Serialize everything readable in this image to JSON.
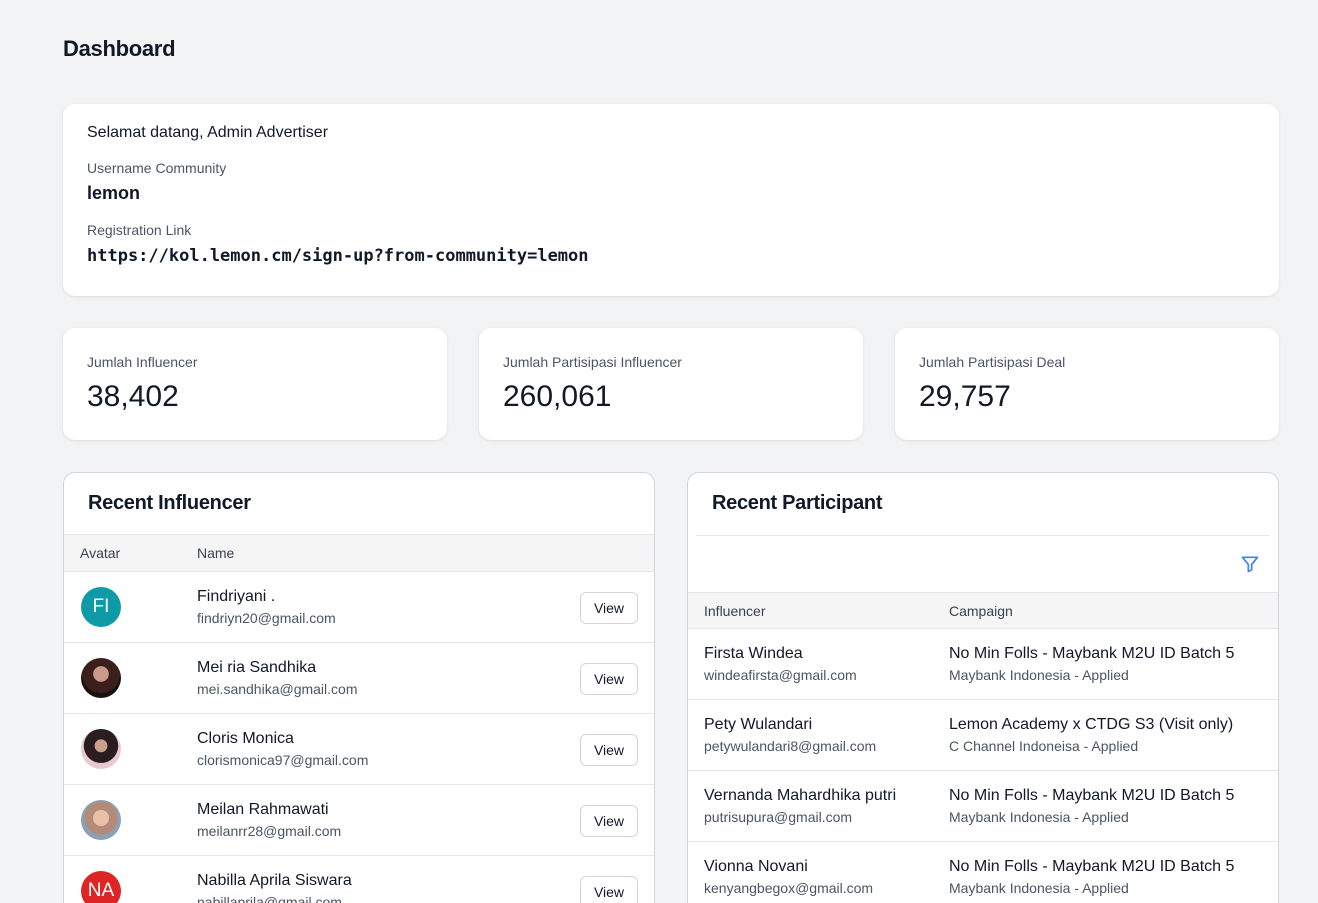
{
  "page": {
    "title": "Dashboard"
  },
  "welcome": {
    "greeting": "Selamat datang, Admin Advertiser",
    "username_label": "Username Community",
    "username": "lemon",
    "link_label": "Registration Link",
    "link": "https://kol.lemon.cm/sign-up?from-community=lemon"
  },
  "stats": [
    {
      "label": "Jumlah Influencer",
      "value": "38,402"
    },
    {
      "label": "Jumlah Partisipasi Influencer",
      "value": "260,061"
    },
    {
      "label": "Jumlah Partisipasi Deal",
      "value": "29,757"
    }
  ],
  "recent_influencer": {
    "title": "Recent Influencer",
    "columns": [
      "Avatar",
      "Name"
    ],
    "view_label": "View",
    "rows": [
      {
        "initials": "FI",
        "name": "Findriyani .",
        "email": "findriyn20@gmail.com"
      },
      {
        "initials": "",
        "name": "Mei ria Sandhika",
        "email": "mei.sandhika@gmail.com"
      },
      {
        "initials": "",
        "name": "Cloris Monica",
        "email": "clorismonica97@gmail.com"
      },
      {
        "initials": "",
        "name": "Meilan Rahmawati",
        "email": "meilanrr28@gmail.com"
      },
      {
        "initials": "NA",
        "name": "Nabilla Aprila Siswara",
        "email": "nabillaprila@gmail.com"
      }
    ]
  },
  "recent_participant": {
    "title": "Recent Participant",
    "columns": [
      "Influencer",
      "Campaign"
    ],
    "rows": [
      {
        "name": "Firsta Windea",
        "email": "windeafirsta@gmail.com",
        "campaign": "No Min Folls - Maybank M2U ID Batch 5",
        "detail": "Maybank Indonesia - Applied"
      },
      {
        "name": "Pety Wulandari",
        "email": "petywulandari8@gmail.com",
        "campaign": "Lemon Academy x CTDG S3 (Visit only)",
        "detail": "C Channel Indoneisa - Applied"
      },
      {
        "name": "Vernanda Mahardhika putri",
        "email": "putrisupura@gmail.com",
        "campaign": "No Min Folls - Maybank M2U ID Batch 5",
        "detail": "Maybank Indonesia - Applied"
      },
      {
        "name": "Vionna Novani",
        "email": "kenyangbegox@gmail.com",
        "campaign": "No Min Folls - Maybank M2U ID Batch 5",
        "detail": "Maybank Indonesia - Applied"
      }
    ]
  },
  "colors": {
    "accent": "#3b82f6",
    "avatar_teal": "#0e9aa7",
    "avatar_red": "#dc2626"
  }
}
